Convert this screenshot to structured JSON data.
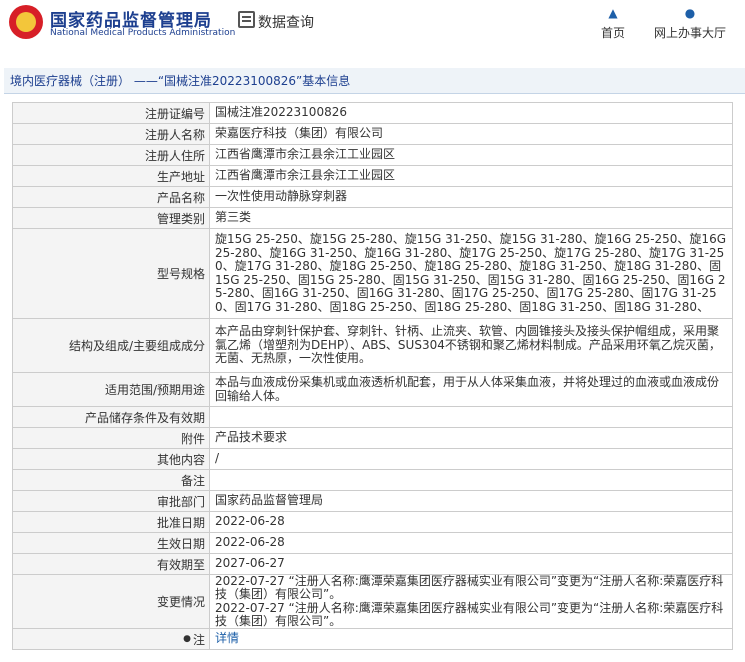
{
  "header": {
    "site_title": "国家药品监督管理局",
    "site_subtitle": "National Medical Products Administration",
    "query_label": "数据查询",
    "nav": [
      {
        "label": "首页",
        "icon": "home-icon"
      },
      {
        "label": "网上办事大厅",
        "icon": "user-icon"
      }
    ]
  },
  "breadcrumb": "境内医疗器械（注册） ——“国械注准20223100826”基本信息",
  "rows": [
    {
      "label": "注册证编号",
      "value": "国械注准20223100826"
    },
    {
      "label": "注册人名称",
      "value": "荣嘉医疗科技（集团）有限公司"
    },
    {
      "label": "注册人住所",
      "value": "江西省鹰潭市余江县余江工业园区"
    },
    {
      "label": "生产地址",
      "value": "江西省鹰潭市余江县余江工业园区"
    },
    {
      "label": "产品名称",
      "value": "一次性使用动静脉穿刺器"
    },
    {
      "label": "管理类别",
      "value": "第三类"
    },
    {
      "label": "型号规格",
      "value": "旋15G 25-250、旋15G 25-280、旋15G 31-250、旋15G 31-280、旋16G 25-250、旋16G 25-280、旋16G 31-250、旋16G 31-280、旋17G 25-250、旋17G 25-280、旋17G 31-250、旋17G 31-280、旋18G 25-250、旋18G 25-280、旋18G 31-250、旋18G 31-280、固15G 25-250、固15G 25-280、固15G 31-250、固15G 31-280、固16G 25-250、固16G 25-280、固16G 31-250、固16G 31-280、固17G 25-250、固17G 25-280、固17G 31-250、固17G 31-280、固18G 25-250、固18G 25-280、固18G 31-250、固18G 31-280、"
    },
    {
      "label": "结构及组成/主要组成成分",
      "value": "本产品由穿刺针保护套、穿刺针、针柄、止流夹、软管、内圆锥接头及接头保护帽组成，采用聚氯乙烯（增塑剂为DEHP）、ABS、SUS304不锈钢和聚乙烯材料制成。产品采用环氧乙烷灭菌，无菌、无热原，一次性使用。"
    },
    {
      "label": "适用范围/预期用途",
      "value": "本品与血液成份采集机或血液透析机配套，用于从人体采集血液，并将处理过的血液或血液成份回输给人体。"
    },
    {
      "label": "产品储存条件及有效期",
      "value": ""
    },
    {
      "label": "附件",
      "value": "产品技术要求"
    },
    {
      "label": "其他内容",
      "value": "/"
    },
    {
      "label": "备注",
      "value": ""
    },
    {
      "label": "审批部门",
      "value": "国家药品监督管理局"
    },
    {
      "label": "批准日期",
      "value": "2022-06-28"
    },
    {
      "label": "生效日期",
      "value": "2022-06-28"
    },
    {
      "label": "有效期至",
      "value": "2027-06-27"
    },
    {
      "label": "变更情况",
      "value": "2022-07-27 “注册人名称:鹰潭荣嘉集团医疗器械实业有限公司”变更为“注册人名称:荣嘉医疗科技（集团）有限公司”。\n2022-07-27 “注册人名称:鹰潭荣嘉集团医疗器械实业有限公司”变更为“注册人名称:荣嘉医疗科技（集团）有限公司”。"
    }
  ],
  "note_row": {
    "label": "注",
    "link": "详情"
  }
}
